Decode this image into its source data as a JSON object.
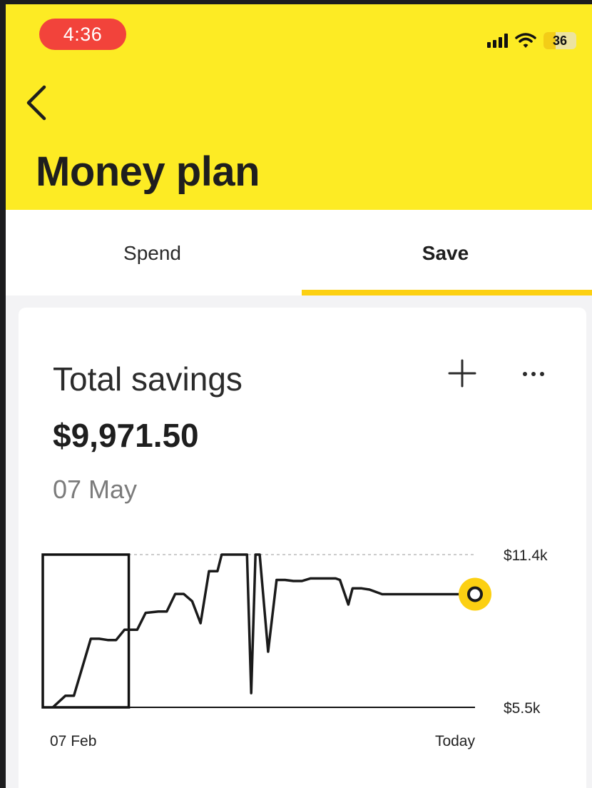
{
  "status_bar": {
    "time": "4:36",
    "battery": "36"
  },
  "header": {
    "title": "Money plan"
  },
  "tabs": [
    {
      "label": "Spend",
      "active": false
    },
    {
      "label": "Save",
      "active": true
    }
  ],
  "card": {
    "title": "Total savings",
    "amount": "$9,971.50",
    "date": "07 May"
  },
  "icons": {
    "back": "chevron-left-icon",
    "add": "plus-icon",
    "more": "more-horizontal-icon"
  },
  "colors": {
    "header": "#fdeb24",
    "accent": "#fcd012",
    "time_pill": "#f2433b"
  },
  "chart_data": {
    "type": "line",
    "y_top_label": "$11.4k",
    "y_bottom_label": "$5.5k",
    "ylim": [
      5500,
      11400
    ],
    "x_start_label": "07 Feb",
    "x_end_label": "Today",
    "series": [
      {
        "points": [
          [
            0,
            5500
          ],
          [
            3,
            5950
          ],
          [
            5,
            5950
          ],
          [
            9,
            8150
          ],
          [
            11,
            8150
          ],
          [
            13,
            8100
          ],
          [
            15,
            8100
          ],
          [
            17,
            8500
          ],
          [
            20,
            8500
          ],
          [
            22,
            9150
          ],
          [
            25,
            9200
          ],
          [
            27,
            9200
          ],
          [
            29,
            9880
          ],
          [
            31,
            9880
          ],
          [
            33,
            9600
          ],
          [
            35,
            8750
          ],
          [
            37,
            10760
          ],
          [
            39,
            10760
          ],
          [
            40,
            11400
          ],
          [
            43,
            11400
          ],
          [
            46,
            11400
          ],
          [
            47,
            6050
          ],
          [
            48,
            11400
          ],
          [
            49,
            11400
          ],
          [
            51,
            7650
          ],
          [
            53,
            10420
          ],
          [
            55,
            10420
          ],
          [
            57,
            10380
          ],
          [
            59,
            10380
          ],
          [
            61,
            10480
          ],
          [
            64,
            10480
          ],
          [
            67,
            10480
          ],
          [
            68,
            10420
          ],
          [
            70,
            9470
          ],
          [
            71,
            10100
          ],
          [
            73,
            10100
          ],
          [
            75,
            10050
          ],
          [
            78,
            9870
          ],
          [
            83,
            9870
          ],
          [
            90,
            9870
          ],
          [
            100,
            9870
          ]
        ],
        "end_marker": true
      }
    ],
    "highlight_range": [
      0,
      18
    ]
  }
}
